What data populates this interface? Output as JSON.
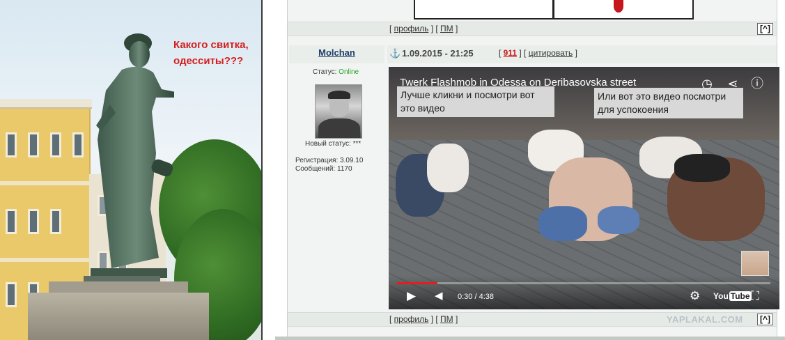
{
  "photo": {
    "caption": "Какого свитка, одесситы???"
  },
  "forum": {
    "prev_post_actions": {
      "profile": "профиль",
      "pm": "ПМ",
      "up": "[^]"
    },
    "post": {
      "author": "Molchan",
      "date": "1.09.2015 - 21:25",
      "post_number": "911",
      "quote_label": "цитировать",
      "status_label": "Статус:",
      "status_value": "Online",
      "new_status_label": "Новый статус: ***",
      "registration_label": "Регистрация:",
      "registration_value": "3.09.10",
      "messages_label": "Сообщений:",
      "messages_value": "1170",
      "actions": {
        "profile": "профиль",
        "pm": "ПМ",
        "up": "[^]"
      }
    },
    "video": {
      "title": "Twerk Flashmob in Odessa on Deribasovska street",
      "note_left": "Лучше кликни и посмотри вот это видео",
      "note_right": "Или вот это видео посмотри для успокоения",
      "time": "0:30 / 4:38",
      "progress": 0.108,
      "youtube_label": "You",
      "youtube_tube": "Tube"
    },
    "watermark": "YAPLAKAL.COM",
    "colors": {
      "caption_red": "#d41f1f",
      "author_blue": "#1d3d67",
      "online_green": "#27a327",
      "post_number_red": "#c81d1d",
      "progress_red": "#e11f1f"
    }
  }
}
